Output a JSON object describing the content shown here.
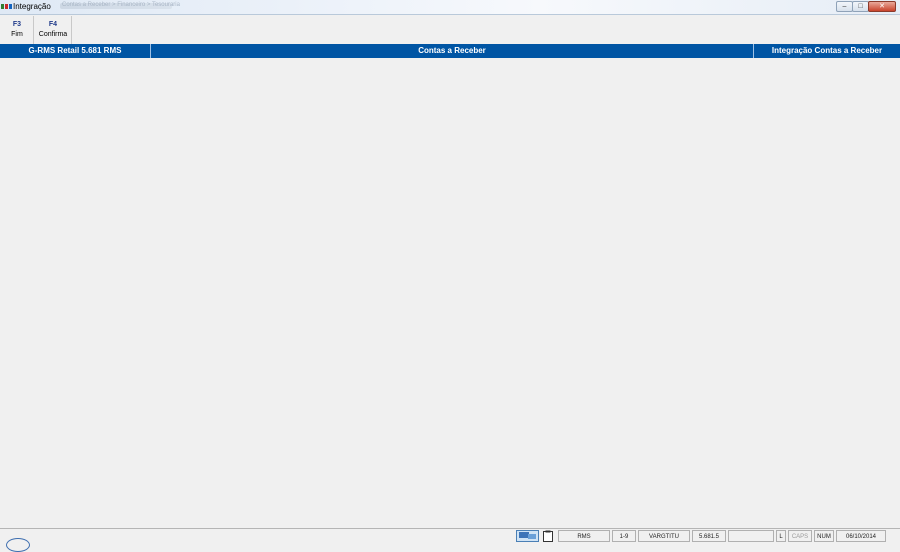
{
  "window": {
    "title": "Integração",
    "subtitle": "Contas a Receber > Financeiro > Tesouraria",
    "controls": {
      "minimize": "–",
      "maximize": "□",
      "close": "✕"
    }
  },
  "toolbar": {
    "buttons": [
      {
        "key": "F3",
        "label": "Fim"
      },
      {
        "key": "F4",
        "label": "Confirma"
      }
    ]
  },
  "header": {
    "left": "G-RMS Retail 5.681 RMS",
    "center": "Contas a Receber",
    "right": "Integração Contas a Receber"
  },
  "status": {
    "system": "RMS",
    "range": "1-9",
    "program": "VARGTITU",
    "version": "5.681.5",
    "empty": "",
    "l": "L",
    "caps": "CAPS",
    "num": "NUM",
    "date": "06/10/2014"
  },
  "colors": {
    "header_bg": "#0055a4",
    "toolbar_key": "#1f3a8a",
    "background": "#f0f0f0"
  }
}
